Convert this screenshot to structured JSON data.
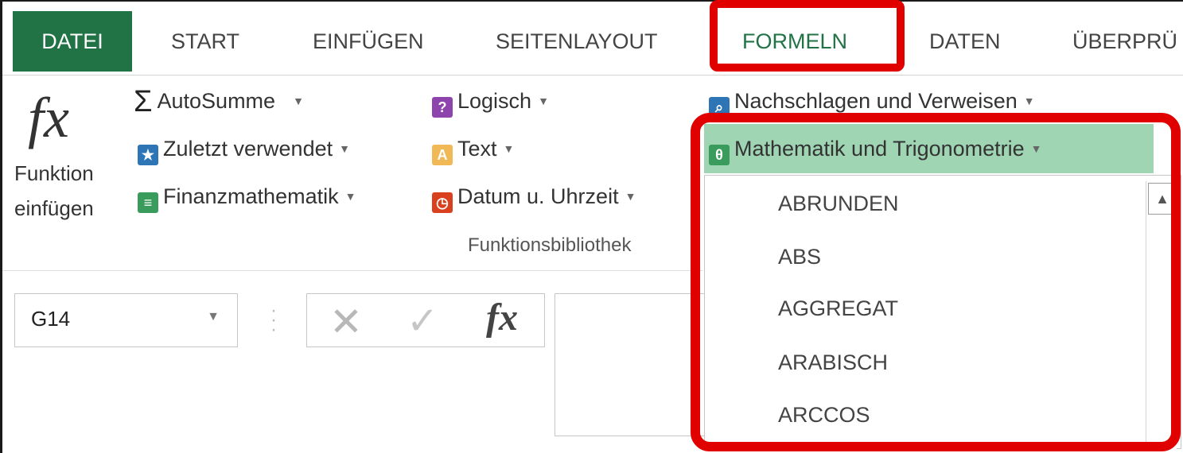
{
  "tabs": [
    {
      "label": "DATEI"
    },
    {
      "label": "START"
    },
    {
      "label": "EINFÜGEN"
    },
    {
      "label": "SEITENLAYOUT"
    },
    {
      "label": "FORMELN"
    },
    {
      "label": "DATEN"
    },
    {
      "label": "ÜBERPRÜ"
    }
  ],
  "active_tab": "FORMELN",
  "ribbon": {
    "insert_function": {
      "line1": "Funktion",
      "line2": "einfügen",
      "icon": "fx-icon"
    },
    "commands": {
      "autosum": "AutoSumme",
      "recently_used": "Zuletzt verwendet",
      "financial": "Finanzmathematik",
      "logical": "Logisch",
      "text": "Text",
      "date_time": "Datum u. Uhrzeit",
      "lookup": "Nachschlagen und Verweisen",
      "math_trig": "Mathematik und Trigonometrie"
    },
    "group_label": "Funktionsbibliothek"
  },
  "formula_bar": {
    "name_box_value": "G14",
    "fx_label": "fx"
  },
  "dropdown": {
    "items": [
      "ABRUNDEN",
      "ABS",
      "AGGREGAT",
      "ARABISCH",
      "ARCCOS"
    ]
  },
  "colors": {
    "excel_green": "#217346",
    "highlight_green": "#9fd5b3",
    "annotation_red": "#e00000"
  }
}
